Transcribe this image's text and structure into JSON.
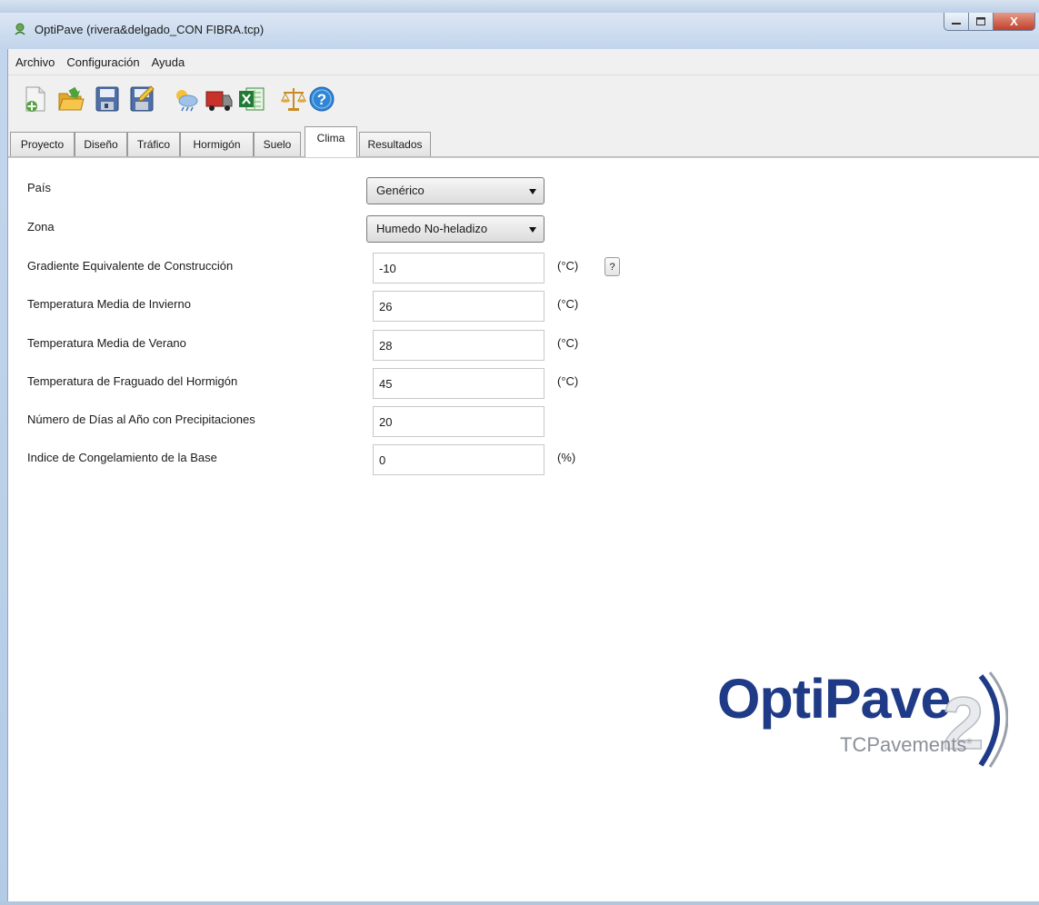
{
  "window": {
    "title": "OptiPave  (rivera&delgado_CON FIBRA.tcp)",
    "controls": {
      "minimize": "–",
      "maximize": "□",
      "close": "X"
    }
  },
  "menu": {
    "items": [
      "Archivo",
      "Configuración",
      "Ayuda"
    ]
  },
  "toolbar": {
    "icons": [
      "new-file-icon",
      "open-folder-icon",
      "save-icon",
      "save-as-icon",
      "weather-icon",
      "truck-icon",
      "excel-icon",
      "balance-scale-icon",
      "help-icon"
    ]
  },
  "tabs": [
    {
      "label": "Proyecto",
      "active": false
    },
    {
      "label": "Diseño",
      "active": false
    },
    {
      "label": "Tráfico",
      "active": false
    },
    {
      "label": "Hormigón",
      "active": false
    },
    {
      "label": "Suelo",
      "active": false
    },
    {
      "label": "Clima",
      "active": true
    },
    {
      "label": "Resultados",
      "active": false
    }
  ],
  "form": {
    "pais": {
      "label": "País",
      "value": "Genérico"
    },
    "zona": {
      "label": "Zona",
      "value": "Humedo No-heladizo"
    },
    "gradiente": {
      "label": "Gradiente Equivalente de Construcción",
      "value": "-10",
      "unit": "(°C)",
      "help": "?"
    },
    "temp_invierno": {
      "label": "Temperatura Media de Invierno",
      "value": "26",
      "unit": "(°C)"
    },
    "temp_verano": {
      "label": "Temperatura Media de Verano",
      "value": "28",
      "unit": "(°C)"
    },
    "temp_fraguado": {
      "label": "Temperatura de Fraguado del Hormigón",
      "value": "45",
      "unit": "(°C)"
    },
    "dias_precip": {
      "label": "Número de Días al Año con Precipitaciones",
      "value": "20"
    },
    "indice_congel": {
      "label": "Indice de Congelamiento de la Base",
      "value": "0",
      "unit": "(%)"
    }
  },
  "logo": {
    "name": "OptiPave",
    "version": "2",
    "company": "TCPavements",
    "mark": "®"
  },
  "colors": {
    "logo_blue": "#1f3a86",
    "logo_gray": "#8b8f97",
    "frame_blue": "#c2d5ec"
  }
}
